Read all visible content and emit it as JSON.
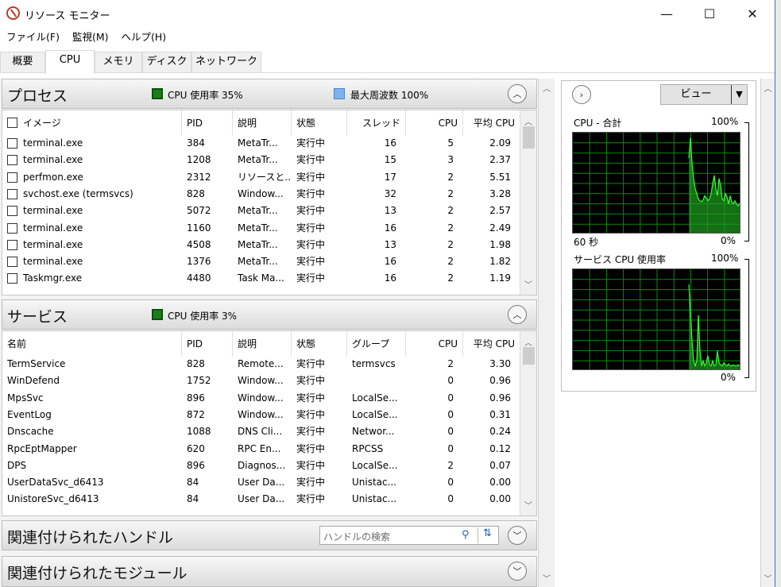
{
  "window": {
    "title": "リソース モニター",
    "minimize_glyph": "—",
    "maximize_glyph": "☐",
    "close_glyph": "✕"
  },
  "menu": [
    "ファイル(F)",
    "監視(M)",
    "ヘルプ(H)"
  ],
  "tabs": [
    "概要",
    "CPU",
    "メモリ",
    "ディスク",
    "ネットワーク"
  ],
  "active_tab": "CPU",
  "processes": {
    "title": "プロセス",
    "cpu_usage_label": "CPU 使用率 35%",
    "max_freq_label": "最大周波数 100%",
    "columns": [
      "イメージ",
      "PID",
      "説明",
      "状態",
      "スレッド",
      "CPU",
      "平均 CPU"
    ],
    "rows": [
      {
        "image": "terminal.exe",
        "pid": "384",
        "desc": "MetaTr...",
        "state": "実行中",
        "threads": "16",
        "cpu": "5",
        "avg": "2.09"
      },
      {
        "image": "terminal.exe",
        "pid": "1208",
        "desc": "MetaTr...",
        "state": "実行中",
        "threads": "15",
        "cpu": "3",
        "avg": "2.37"
      },
      {
        "image": "perfmon.exe",
        "pid": "2312",
        "desc": "リソースと...",
        "state": "実行中",
        "threads": "17",
        "cpu": "2",
        "avg": "5.51"
      },
      {
        "image": "svchost.exe (termsvcs)",
        "pid": "828",
        "desc": "Window...",
        "state": "実行中",
        "threads": "32",
        "cpu": "2",
        "avg": "3.28"
      },
      {
        "image": "terminal.exe",
        "pid": "5072",
        "desc": "MetaTr...",
        "state": "実行中",
        "threads": "13",
        "cpu": "2",
        "avg": "2.57"
      },
      {
        "image": "terminal.exe",
        "pid": "1160",
        "desc": "MetaTr...",
        "state": "実行中",
        "threads": "16",
        "cpu": "2",
        "avg": "2.49"
      },
      {
        "image": "terminal.exe",
        "pid": "4508",
        "desc": "MetaTr...",
        "state": "実行中",
        "threads": "13",
        "cpu": "2",
        "avg": "1.98"
      },
      {
        "image": "terminal.exe",
        "pid": "1376",
        "desc": "MetaTr...",
        "state": "実行中",
        "threads": "16",
        "cpu": "2",
        "avg": "1.82"
      },
      {
        "image": "Taskmgr.exe",
        "pid": "4480",
        "desc": "Task Ma...",
        "state": "実行中",
        "threads": "16",
        "cpu": "2",
        "avg": "1.19"
      }
    ]
  },
  "services": {
    "title": "サービス",
    "cpu_usage_label": "CPU 使用率 3%",
    "columns": [
      "名前",
      "PID",
      "説明",
      "状態",
      "グループ",
      "CPU",
      "平均 CPU"
    ],
    "rows": [
      {
        "name": "TermService",
        "pid": "828",
        "desc": "Remote...",
        "state": "実行中",
        "group": "termsvcs",
        "cpu": "2",
        "avg": "3.30"
      },
      {
        "name": "WinDefend",
        "pid": "1752",
        "desc": "Window...",
        "state": "実行中",
        "group": "",
        "cpu": "0",
        "avg": "0.96"
      },
      {
        "name": "MpsSvc",
        "pid": "896",
        "desc": "Window...",
        "state": "実行中",
        "group": "LocalSe...",
        "cpu": "0",
        "avg": "0.96"
      },
      {
        "name": "EventLog",
        "pid": "872",
        "desc": "Window...",
        "state": "実行中",
        "group": "LocalSe...",
        "cpu": "0",
        "avg": "0.31"
      },
      {
        "name": "Dnscache",
        "pid": "1088",
        "desc": "DNS Cli...",
        "state": "実行中",
        "group": "Networ...",
        "cpu": "0",
        "avg": "0.24"
      },
      {
        "name": "RpcEptMapper",
        "pid": "620",
        "desc": "RPC En...",
        "state": "実行中",
        "group": "RPCSS",
        "cpu": "0",
        "avg": "0.12"
      },
      {
        "name": "DPS",
        "pid": "896",
        "desc": "Diagnos...",
        "state": "実行中",
        "group": "LocalSe...",
        "cpu": "2",
        "avg": "0.07"
      },
      {
        "name": "UserDataSvc_d6413",
        "pid": "84",
        "desc": "User Da...",
        "state": "実行中",
        "group": "Unistac...",
        "cpu": "0",
        "avg": "0.00"
      },
      {
        "name": "UnistoreSvc_d6413",
        "pid": "84",
        "desc": "User Da...",
        "state": "実行中",
        "group": "Unistac...",
        "cpu": "0",
        "avg": "0.00"
      }
    ]
  },
  "handles": {
    "title": "関連付けられたハンドル",
    "search_placeholder": "ハンドルの検索"
  },
  "modules": {
    "title": "関連付けられたモジュール"
  },
  "right_panel": {
    "view_label": "ビュー",
    "graph1": {
      "title": "CPU - 合計",
      "max": "100%",
      "time": "60 秒",
      "min": "0%"
    },
    "graph2": {
      "title": "サービス CPU 使用率",
      "max": "100%",
      "min": "0%"
    }
  },
  "colors": {
    "graph_grid": "#0a8a0a",
    "graph_line": "#33ff33",
    "graph_fill": "#1e9e1e",
    "cpu_legend": "#1a7f1a",
    "freq_legend": "#7fb2ea"
  },
  "icons": {
    "expand": "chevron-up-icon",
    "collapse": "chevron-down-icon",
    "panel_toggle": "chevron-right-icon",
    "search": "search-icon",
    "refresh": "refresh-icon"
  }
}
